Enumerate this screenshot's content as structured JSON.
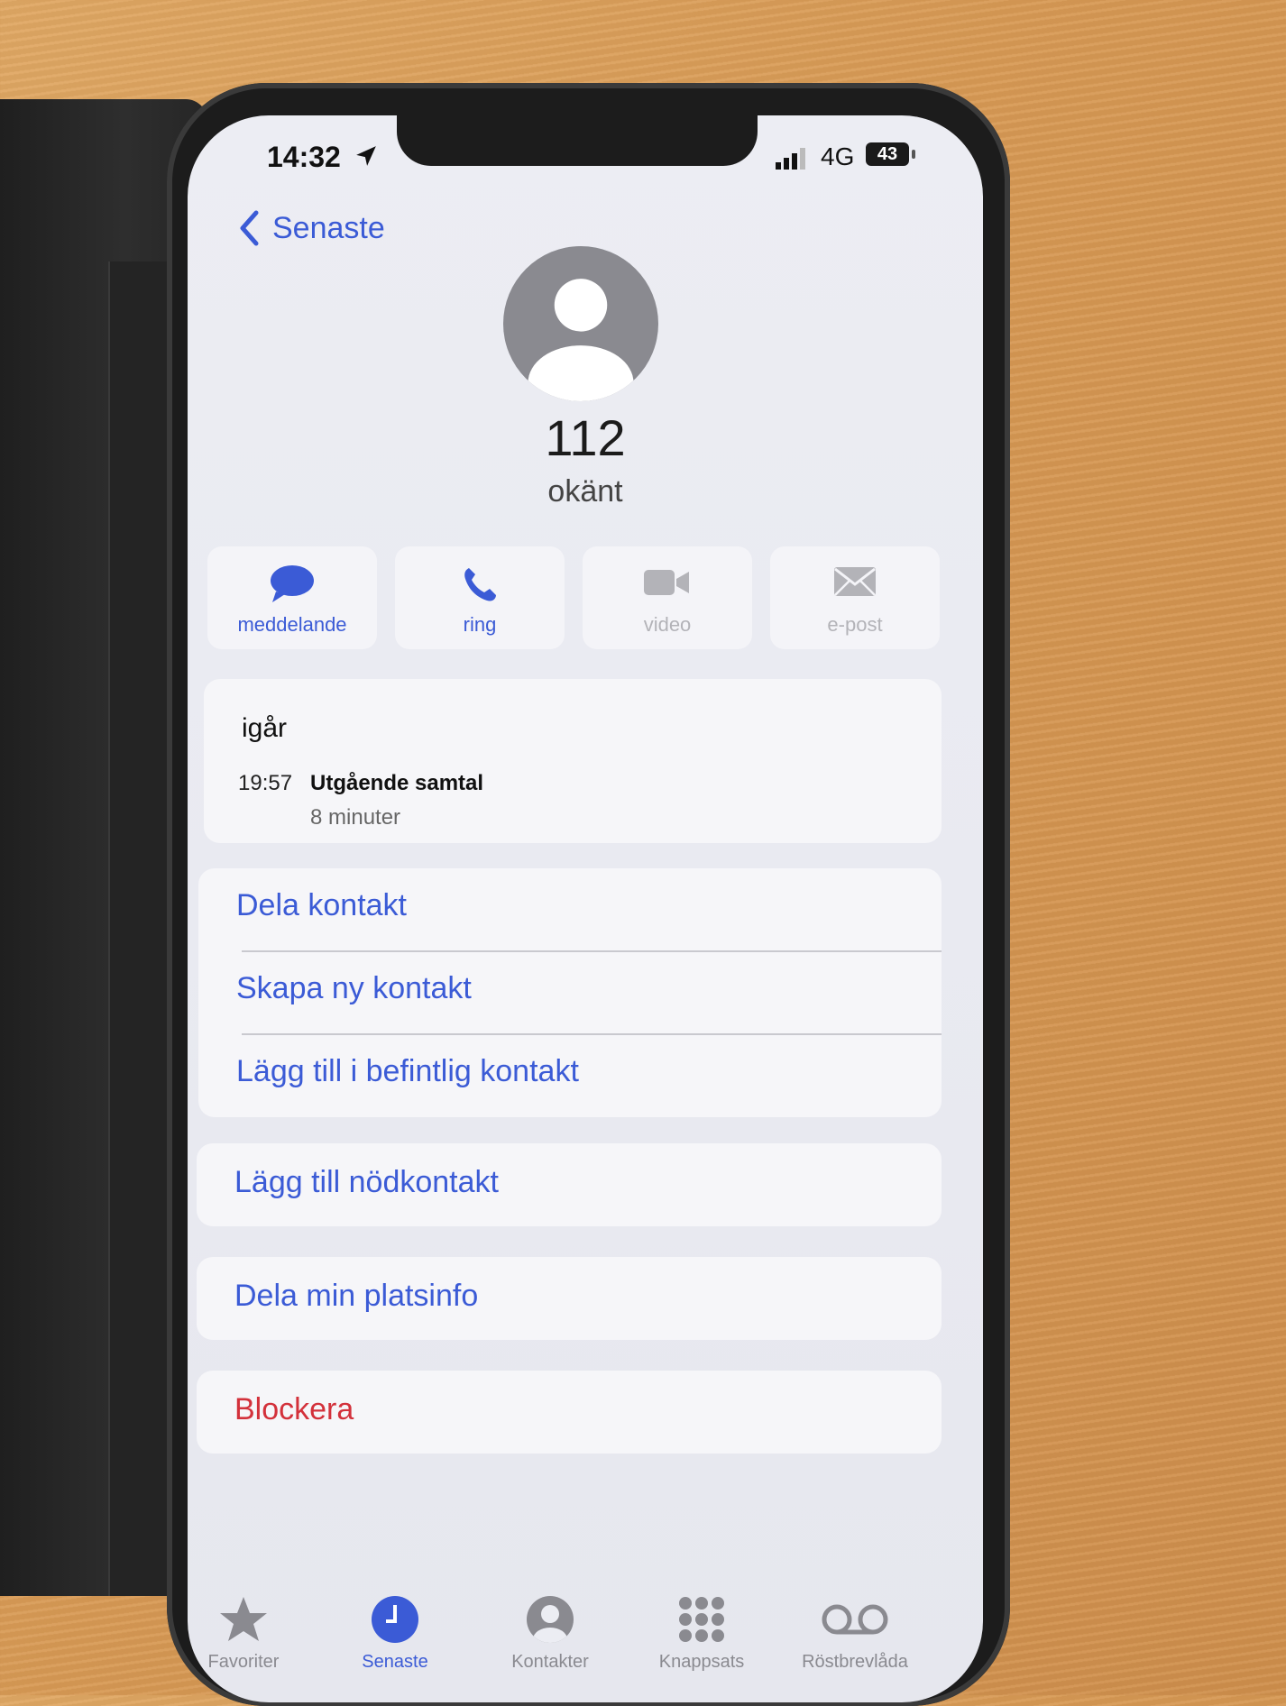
{
  "status_bar": {
    "time": "14:32",
    "network": "4G",
    "battery": "43"
  },
  "nav": {
    "back_label": "Senaste"
  },
  "contact": {
    "number": "112",
    "subtitle": "okänt"
  },
  "actions": [
    {
      "label": "meddelande",
      "icon": "message-bubble-icon",
      "enabled": true
    },
    {
      "label": "ring",
      "icon": "phone-icon",
      "enabled": true
    },
    {
      "label": "video",
      "icon": "video-camera-icon",
      "enabled": false
    },
    {
      "label": "e-post",
      "icon": "mail-icon",
      "enabled": false
    }
  ],
  "recent": {
    "day": "igår",
    "time": "19:57",
    "type": "Utgående samtal",
    "duration": "8 minuter"
  },
  "contact_options": [
    "Dela kontakt",
    "Skapa ny kontakt",
    "Lägg till i befintlig kontakt"
  ],
  "emergency": "Lägg till nödkontakt",
  "share_location": "Dela min platsinfo",
  "block": "Blockera",
  "tabs": [
    {
      "label": "Favoriter",
      "icon": "star-icon",
      "active": false
    },
    {
      "label": "Senaste",
      "icon": "clock-icon",
      "active": true
    },
    {
      "label": "Kontakter",
      "icon": "person-circle-icon",
      "active": false
    },
    {
      "label": "Knappsats",
      "icon": "keypad-icon",
      "active": false
    },
    {
      "label": "Röstbrevlåda",
      "icon": "voicemail-icon",
      "active": false
    }
  ],
  "colors": {
    "accent": "#3b5bd6",
    "destructive": "#d3313b",
    "disabled": "#b3b3b8"
  }
}
